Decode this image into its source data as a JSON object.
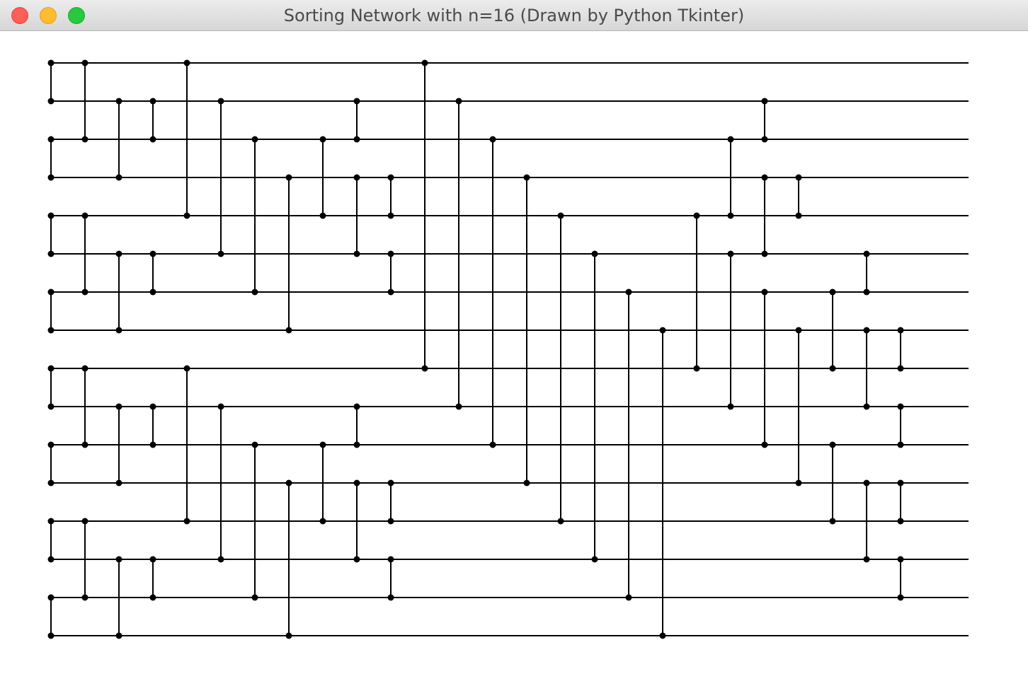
{
  "window": {
    "title": "Sorting Network with n=16 (Drawn by Python Tkinter)",
    "controls": {
      "close_color": "#fe5f57",
      "minimize_color": "#febc2e",
      "zoom_color": "#28c840"
    }
  },
  "network": {
    "n": 16,
    "line_color": "#000000",
    "comparators": [
      [
        0,
        1
      ],
      [
        2,
        3
      ],
      [
        4,
        5
      ],
      [
        6,
        7
      ],
      [
        8,
        9
      ],
      [
        10,
        11
      ],
      [
        12,
        13
      ],
      [
        14,
        15
      ],
      [
        0,
        2
      ],
      [
        4,
        6
      ],
      [
        8,
        10
      ],
      [
        12,
        14
      ],
      [
        1,
        3
      ],
      [
        5,
        7
      ],
      [
        9,
        11
      ],
      [
        13,
        15
      ],
      [
        1,
        2
      ],
      [
        5,
        6
      ],
      [
        9,
        10
      ],
      [
        13,
        14
      ],
      [
        0,
        4
      ],
      [
        8,
        12
      ],
      [
        1,
        5
      ],
      [
        9,
        13
      ],
      [
        2,
        6
      ],
      [
        10,
        14
      ],
      [
        3,
        7
      ],
      [
        11,
        15
      ],
      [
        2,
        4
      ],
      [
        10,
        12
      ],
      [
        3,
        5
      ],
      [
        11,
        13
      ],
      [
        1,
        2
      ],
      [
        3,
        4
      ],
      [
        5,
        6
      ],
      [
        9,
        10
      ],
      [
        11,
        12
      ],
      [
        13,
        14
      ],
      [
        0,
        8
      ],
      [
        1,
        9
      ],
      [
        2,
        10
      ],
      [
        3,
        11
      ],
      [
        4,
        12
      ],
      [
        5,
        13
      ],
      [
        6,
        14
      ],
      [
        7,
        15
      ],
      [
        4,
        8
      ],
      [
        5,
        9
      ],
      [
        6,
        10
      ],
      [
        7,
        11
      ],
      [
        2,
        4
      ],
      [
        6,
        8
      ],
      [
        10,
        12
      ],
      [
        3,
        5
      ],
      [
        7,
        9
      ],
      [
        11,
        13
      ],
      [
        1,
        2
      ],
      [
        3,
        4
      ],
      [
        5,
        6
      ],
      [
        7,
        8
      ],
      [
        9,
        10
      ],
      [
        11,
        12
      ],
      [
        13,
        14
      ]
    ]
  }
}
